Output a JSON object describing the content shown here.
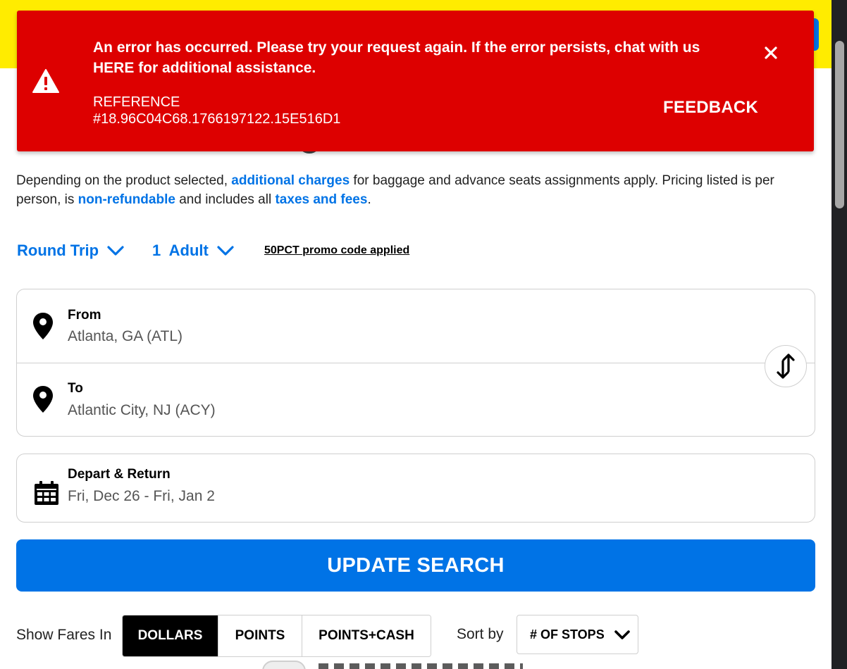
{
  "error_banner": {
    "message_before": "An error has occurred. Please try your request again. If the error persists, chat with us ",
    "message_link": "HERE",
    "message_after": " for additional assistance.",
    "reference_label": "REFERENCE",
    "reference_code": "#18.96C04C68.1766197122.15E516D1",
    "feedback_label": "FEEDBACK",
    "close_icon": "close-icon",
    "warning_icon": "warning-triangle-icon",
    "color": "#dd0000"
  },
  "disclaimer": {
    "part1": "Depending on the product selected, ",
    "link1": "additional charges",
    "part2": " for baggage and advance seats assignments apply. Pricing listed is per person, is ",
    "link2": "non-refundable",
    "part3": " and includes all ",
    "link3": "taxes and fees",
    "part4": "."
  },
  "trip_options": {
    "trip_type": "Round Trip",
    "passengers": "1  Adult",
    "promo": "50PCT promo code applied"
  },
  "route": {
    "from_label": "From",
    "from_value": "Atlanta, GA (ATL)",
    "to_label": "To",
    "to_value": "Atlantic City, NJ (ACY)"
  },
  "dates": {
    "label": "Depart & Return",
    "value": "Fri, Dec 26 - Fri, Jan 2"
  },
  "update_button": "UPDATE SEARCH",
  "fares": {
    "label": "Show Fares In",
    "options": [
      "DOLLARS",
      "POINTS",
      "POINTS+CASH"
    ],
    "selected": "DOLLARS"
  },
  "sort": {
    "label": "Sort by",
    "value": "# OF STOPS"
  },
  "colors": {
    "brand_yellow": "#ffec00",
    "accent_blue": "#0073e6",
    "error_red": "#dd0000"
  }
}
